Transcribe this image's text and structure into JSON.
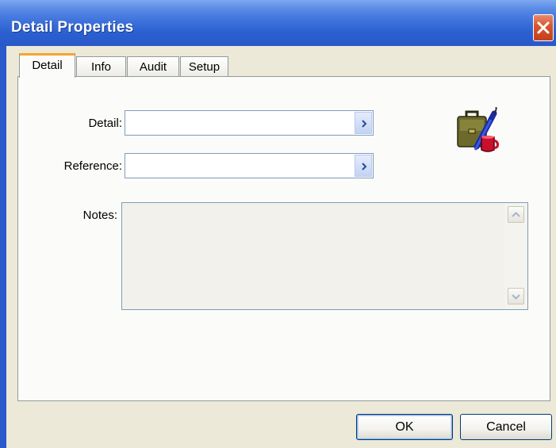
{
  "window": {
    "title": "Detail Properties",
    "close_icon": "close-icon"
  },
  "tabs": [
    {
      "label": "Detail",
      "active": true
    },
    {
      "label": "Info",
      "active": false
    },
    {
      "label": "Audit",
      "active": false
    },
    {
      "label": "Setup",
      "active": false
    }
  ],
  "form": {
    "detail_label": "Detail:",
    "detail_value": "",
    "reference_label": "Reference:",
    "reference_value": "",
    "notes_label": "Notes:",
    "notes_value": ""
  },
  "footer": {
    "ok_label": "OK",
    "cancel_label": "Cancel"
  },
  "colors": {
    "titlebar": "#2b60d1",
    "dialog_bg": "#ece9d8",
    "panel_bg": "#fbfbf9",
    "tab_highlight": "#f5a42f",
    "close_button": "#d8542e"
  },
  "icons": [
    "close-icon",
    "chevron-right-icon",
    "scroll-up-icon",
    "scroll-down-icon",
    "briefcase-umbrella-icon"
  ]
}
